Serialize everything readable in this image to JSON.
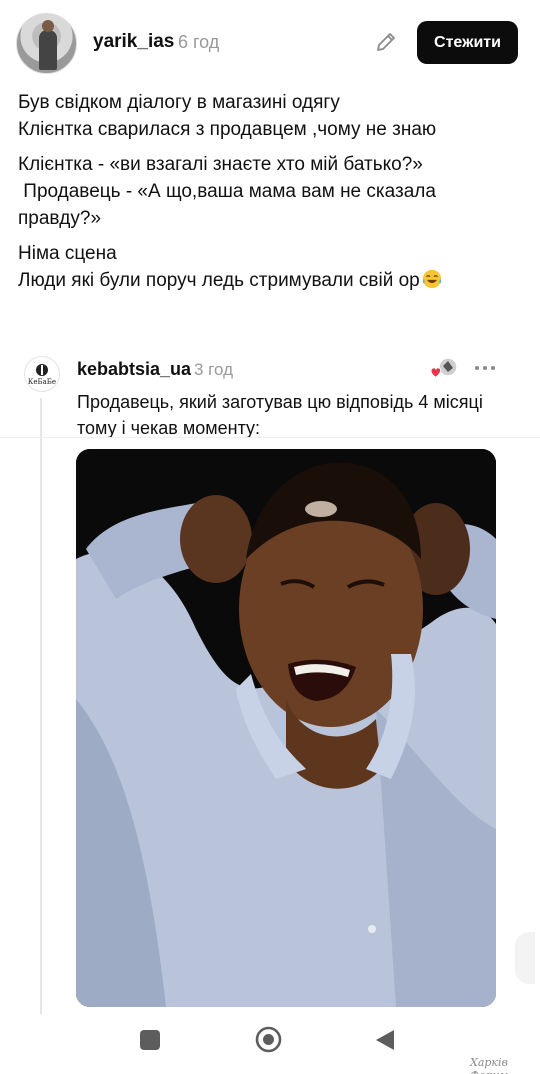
{
  "post": {
    "author": "yarik_ias",
    "time": "6 год",
    "follow_label": "Стежити",
    "paragraphs": [
      "Був свідком діалогу в магазині одягу\nКлієнтка сварилася з продавцем ,чому не знаю",
      "Клієнтка - «ви взагалі знаєте хто мій батько?»\n Продавець - «А що,ваша мама вам не сказала правду?»"
    ],
    "last_paragraph": "Німа сцена\nЛюди які були поруч ледь стримували свій ор",
    "emoji": "tears-of-joy-emoji"
  },
  "reply": {
    "author": "kebabtsia_ua",
    "time": "3 год",
    "avatar_text": "КеБаБе",
    "text": "Продавець, який заготував цю відповідь 4 місяці тому і чекав моменту:",
    "image": "laughing-man-photo"
  },
  "navbar": {
    "icons": [
      "square-icon",
      "home-circle-icon",
      "back-triangle-icon"
    ]
  },
  "watermark": "Харків Форум",
  "colors": {
    "button_bg": "#0c0c0c",
    "muted_text": "#9a9a9a",
    "react_heart": "#e8334a"
  }
}
